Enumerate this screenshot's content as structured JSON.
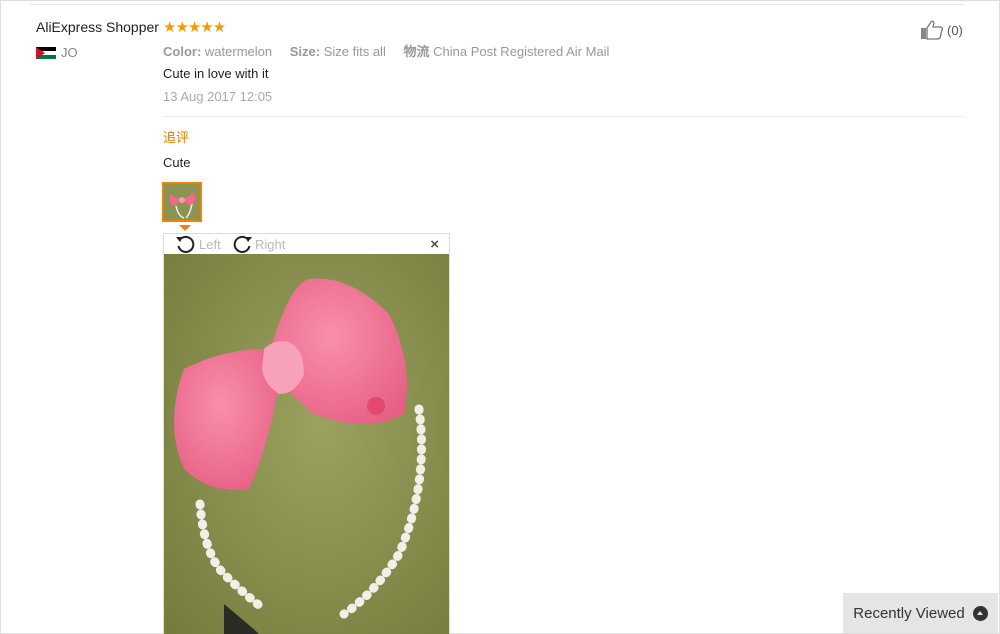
{
  "review": {
    "user_name": "AliExpress Shopper",
    "country_code": "JO",
    "rating": 5,
    "stars": "★★★★★",
    "like_count": "(0)",
    "attributes": {
      "color_label": "Color:",
      "color_value": "watermelon",
      "size_label": "Size:",
      "size_value": "Size fits all",
      "shipping_label": "物流",
      "shipping_value": "China Post Registered Air Mail"
    },
    "comment": "Cute in love with it",
    "date": "13 Aug 2017 12:05",
    "additional": {
      "title": "追评",
      "text": "Cute"
    }
  },
  "viewer": {
    "rotate_left": "Left",
    "rotate_right": "Right",
    "close": "×"
  },
  "footer": {
    "recently_viewed": "Recently Viewed"
  },
  "colors": {
    "star": "#f59b00",
    "accent": "#e67e00",
    "thumb_border": "#f08200"
  }
}
